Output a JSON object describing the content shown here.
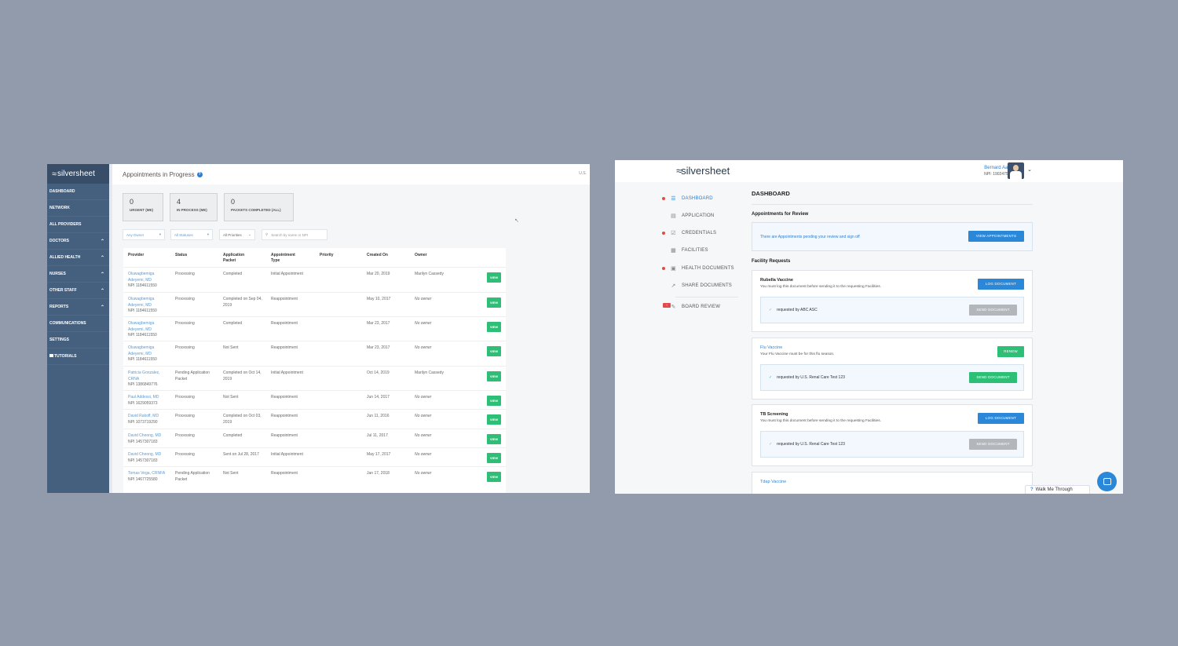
{
  "left": {
    "logo": "silversheet",
    "sidebar": [
      {
        "label": "DASHBOARD",
        "chev": false
      },
      {
        "label": "NETWORK",
        "chev": false
      },
      {
        "label": "ALL PROVIDERS",
        "chev": false
      },
      {
        "label": "DOCTORS",
        "chev": true
      },
      {
        "label": "ALLIED HEALTH",
        "chev": true
      },
      {
        "label": "NURSES",
        "chev": true
      },
      {
        "label": "OTHER STAFF",
        "chev": true
      },
      {
        "label": "REPORTS",
        "chev": true
      },
      {
        "label": "COMMUNICATIONS",
        "chev": false
      },
      {
        "label": "SETTINGS",
        "chev": false
      },
      {
        "label": "TUTORIALS",
        "chev": false,
        "icon": "youtube-icon"
      }
    ],
    "page_title": "Appointments in Progress",
    "region": "U.S.",
    "stats": [
      {
        "num": "0",
        "label": "URGENT (ME)"
      },
      {
        "num": "4",
        "label": "IN PROCESS (ME)"
      },
      {
        "num": "0",
        "label": "PACKETS COMPLETED (ALL)"
      }
    ],
    "filters": {
      "owner": "Any Owner",
      "status": "All Statuses",
      "priority": "All Priorities",
      "search_placeholder": "Search by name or NPI"
    },
    "columns": [
      "Provider",
      "Status",
      "Application Packet",
      "Appointment Type",
      "Priority",
      "Created On",
      "Owner"
    ],
    "view_label": "VIEW",
    "rows": [
      {
        "provider": "Oluwagbemiga Adeyemi, MD",
        "npi": "NPI 1184611550",
        "status": "Processing",
        "packet": "Completed",
        "type": "Initial Appointment",
        "created": "Mar 20, 2019",
        "owner": "Marilyn Cassedy",
        "no_owner": false
      },
      {
        "provider": "Oluwagbemiga Adeyemi, MD",
        "npi": "NPI 1184611550",
        "status": "Processing",
        "packet": "Completed on Sep 04, 2019",
        "type": "Reappointment",
        "created": "May 10, 2017",
        "owner": "No owner",
        "no_owner": true
      },
      {
        "provider": "Oluwagbemiga Adeyemi, MD",
        "npi": "NPI 1184611550",
        "status": "Processing",
        "packet": "Completed",
        "type": "Reappointment",
        "created": "Mar 23, 2017",
        "owner": "No owner",
        "no_owner": true
      },
      {
        "provider": "Oluwagbemiga Adeyemi, MD",
        "npi": "NPI 1184611550",
        "status": "Processing",
        "packet": "Not Sent",
        "type": "Reappointment",
        "created": "Mar 23, 2017",
        "owner": "No owner",
        "no_owner": true
      },
      {
        "provider": "Patricia Gonzalez, CRNA",
        "npi": "NPI 1386849776",
        "status": "Pending Application Packet",
        "packet": "Completed on Oct 14, 2019",
        "type": "Initial Appointment",
        "created": "Oct 14, 2019",
        "owner": "Marilyn Cassedy",
        "no_owner": false
      },
      {
        "provider": "Paul Addessi, MD",
        "npi": "NPI 1629059373",
        "status": "Processing",
        "packet": "Not Sent",
        "type": "Reappointment",
        "created": "Jun 14, 2017",
        "owner": "No owner",
        "no_owner": true
      },
      {
        "provider": "David Rakoff, MD",
        "npi": "NPI 1073719290",
        "status": "Processing",
        "packet": "Completed on Oct 03, 2019",
        "type": "Reappointment",
        "created": "Jun 11, 2016",
        "owner": "No owner",
        "no_owner": true
      },
      {
        "provider": "David Cheong, MD",
        "npi": "NPI 1457307183",
        "status": "Processing",
        "packet": "Completed",
        "type": "Reappointment",
        "created": "Jul 11, 2017",
        "owner": "No owner",
        "no_owner": true
      },
      {
        "provider": "David Cheong, MD",
        "npi": "NPI 1457307183",
        "status": "Processing",
        "packet": "Sent on Jul 28, 2017",
        "type": "Initial Appointment",
        "created": "May 17, 2017",
        "owner": "No owner",
        "no_owner": true
      },
      {
        "provider": "Tomas Vega, CRNFA",
        "npi": "NPI 1467725580",
        "status": "Pending Application Packet",
        "packet": "Not Sent",
        "type": "Reappointment",
        "created": "Jan 17, 2018",
        "owner": "No owner",
        "no_owner": true
      }
    ]
  },
  "right": {
    "logo": "silversheet",
    "user": {
      "name": "Bernard Aaron",
      "npi": "NPI: 1902475566"
    },
    "nav": [
      {
        "label": "DASHBOARD",
        "dot": true,
        "active": true,
        "icon": "dashboard-icon",
        "glyph": "☰"
      },
      {
        "label": "APPLICATION",
        "dot": false,
        "active": false,
        "icon": "document-icon",
        "glyph": "▤"
      },
      {
        "label": "CREDENTIALS",
        "dot": true,
        "active": false,
        "icon": "checkbox-icon",
        "glyph": "☑"
      },
      {
        "label": "FACILITIES",
        "dot": false,
        "active": false,
        "icon": "building-icon",
        "glyph": "▦"
      },
      {
        "label": "HEALTH DOCUMENTS",
        "dot": true,
        "active": false,
        "icon": "medical-kit-icon",
        "glyph": "▣"
      },
      {
        "label": "SHARE DOCUMENTS",
        "dot": false,
        "active": false,
        "icon": "share-icon",
        "glyph": "↗"
      },
      {
        "label": "BOARD REVIEW",
        "dot": false,
        "active": false,
        "icon": "edit-icon",
        "glyph": "✎"
      }
    ],
    "dashboard_title": "DASHBOARD",
    "appointments_section": "Appointments for Review",
    "appointments_message": "There are Appointments pending your review and sign off",
    "view_appointments": "VIEW APPOINTMENTS",
    "facility_section": "Facility Requests",
    "requests": [
      {
        "name": "Rubella Vaccine",
        "desc": "You must log this document before sending it to the requesting Facilities.",
        "action": "LOG DOCUMENT",
        "action_color": "blue",
        "requested": "requested by ABC ASC",
        "send": "SEND DOCUMENT",
        "send_color": "grey",
        "checked": false,
        "name_link": false
      },
      {
        "name": "Flu Vaccine",
        "desc": "Your Flu Vaccine must be for this flu season.",
        "action": "RENEW",
        "action_color": "green",
        "requested": "requested by U.S. Renal Care Test 123",
        "send": "SEND DOCUMENT",
        "send_color": "green",
        "checked": true,
        "name_link": true
      },
      {
        "name": "TB Screening",
        "desc": "You must log this document before sending it to the requesting Facilities.",
        "action": "LOG DOCUMENT",
        "action_color": "blue",
        "requested": "requested by U.S. Renal Care Test 123",
        "send": "SEND DOCUMENT",
        "send_color": "grey",
        "checked": false,
        "name_link": false
      }
    ],
    "partial_item": "Tdap Vaccine",
    "walk_me_through": "Walk Me Through"
  }
}
